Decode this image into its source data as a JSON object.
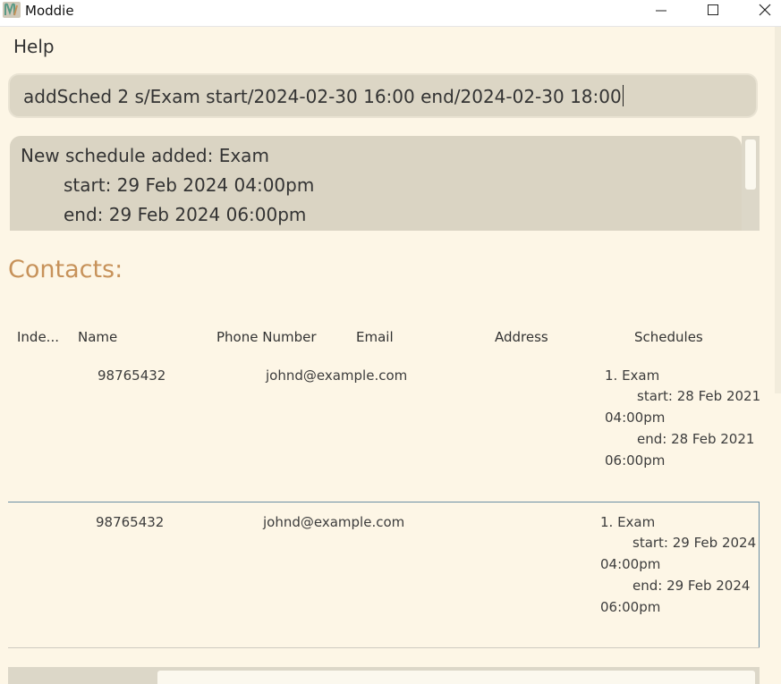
{
  "window": {
    "title": "Moddie",
    "icon": "app-logo-icon",
    "controls": [
      "minimize-icon",
      "maximize-icon",
      "close-icon"
    ]
  },
  "menu": {
    "help_label": "Help"
  },
  "command_box": {
    "value": "addSched 2 s/Exam start/2024-02-30 16:00 end/2024-02-30 18:00"
  },
  "result_display": {
    "lines": [
      "New schedule added: Exam",
      "start: 29 Feb 2024 04:00pm",
      "end: 29 Feb 2024 06:00pm"
    ]
  },
  "contacts": {
    "title": "Contacts:",
    "columns": [
      "Inde...",
      "Name",
      "Phone Number",
      "Email",
      "Address",
      "Schedules"
    ],
    "rows": [
      {
        "index": "",
        "name": "",
        "phone": "98765432",
        "email": "johnd@example.com",
        "address": "",
        "schedule_lines": [
          "1. Exam",
          "start: 28 Feb 2021",
          "04:00pm",
          "end: 28 Feb 2021",
          "06:00pm"
        ]
      },
      {
        "index": "",
        "name": "",
        "phone": "98765432",
        "email": "johnd@example.com",
        "address": "",
        "schedule_lines": [
          "1. Exam",
          "start: 29 Feb 2024",
          "04:00pm",
          "end: 29 Feb 2024",
          "06:00pm"
        ]
      }
    ]
  },
  "colors": {
    "background": "#fdf6e6",
    "panel": "#dcd6c5",
    "accent": "#c7925a",
    "selection_border": "#6a8ea3"
  }
}
